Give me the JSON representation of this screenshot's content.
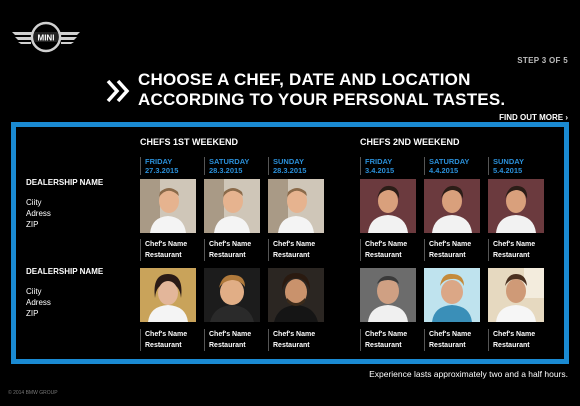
{
  "header": {
    "logo_text": "MINI",
    "step": "STEP 3 OF 5",
    "headline_line1": "CHOOSE A CHEF, DATE AND LOCATION",
    "headline_line2": "ACCORDING TO YOUR PERSONAL TASTES.",
    "find_out_more": "FIND OUT MORE ›"
  },
  "weekends": [
    {
      "title": "CHEFS 1ST WEEKEND",
      "days": [
        {
          "name": "FRIDAY",
          "date": "27.3.2015"
        },
        {
          "name": "SATURDAY",
          "date": "28.3.2015"
        },
        {
          "name": "SUNDAY",
          "date": "28.3.2015"
        }
      ]
    },
    {
      "title": "CHEFS 2ND WEEKEND",
      "days": [
        {
          "name": "FRIDAY",
          "date": "3.4.2015"
        },
        {
          "name": "SATURDAY",
          "date": "4.4.2015"
        },
        {
          "name": "SUNDAY",
          "date": "5.4.2015"
        }
      ]
    }
  ],
  "dealerships": [
    {
      "name": "DEALERSHIP NAME",
      "city": "Ciity",
      "address": "Adress",
      "zip": "ZIP"
    },
    {
      "name": "DEALERSHIP NAME",
      "city": "Ciity",
      "address": "Adress",
      "zip": "ZIP"
    }
  ],
  "chef_card": {
    "name": "Chef's Name",
    "restaurant": "Restaurant"
  },
  "footer": {
    "note": "Experience lasts approximately two and a half  hours.",
    "copyright": "© 2014 BMW GROUP"
  },
  "colors": {
    "accent": "#1a8ad2",
    "day_text": "#2a8fd8",
    "background": "#000000"
  }
}
